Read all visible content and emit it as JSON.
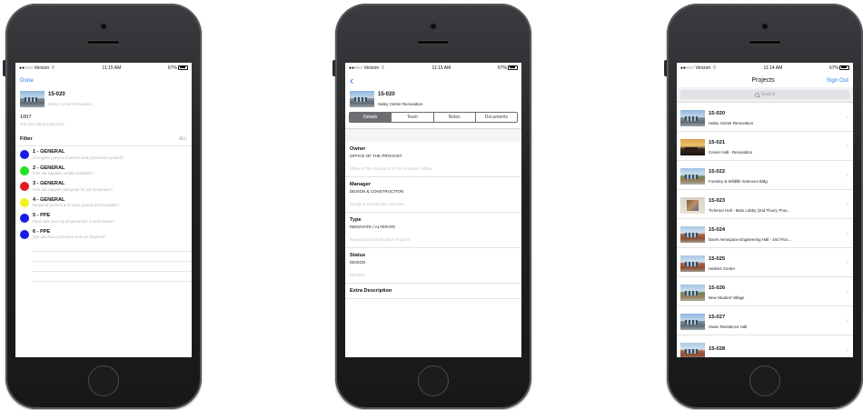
{
  "status_bar": {
    "carrier": "●●○○○ Verizon",
    "wifi_icon": "wifi-icon",
    "battery": "67%",
    "time_1": "11:15 AM",
    "time_2": "11:15 AM",
    "time_3": "11:14 AM"
  },
  "inspection": {
    "nav": {
      "done_label": "Done"
    },
    "project": {
      "number": "15-020",
      "name": "Haley Center Renovation"
    },
    "code": {
      "number": "1007",
      "description": "Job site safety inspection"
    },
    "filter": {
      "label": "Filter",
      "all_label": "ALL"
    },
    "categories": [
      {
        "title": "1 - GENERAL",
        "question": "Emergency phone numbers and procedures posted?",
        "color": "#1a1ae6"
      },
      {
        "title": "2 - GENERAL",
        "question": "First aid supplies readily available?",
        "color": "#22e022"
      },
      {
        "title": "3 - GENERAL",
        "question": "First aid supplies adequate for job manpower?",
        "color": "#e41b1b"
      },
      {
        "title": "4 - GENERAL",
        "question": "Required posters and signs posted and readable?",
        "color": "#f2f21c"
      },
      {
        "title": "5 - PPE",
        "question": "Hard hats worn by all personnel in work areas?",
        "color": "#1a1ae6"
      },
      {
        "title": "6 - PPE",
        "question": "Eye and face protection worn as required?",
        "color": "#1a1ae6"
      }
    ]
  },
  "project_detail": {
    "nav": {
      "back_icon": "chevron-left-icon"
    },
    "project": {
      "number": "15-020",
      "name": "Haley Center Renovation"
    },
    "tabs": [
      "Details",
      "Team",
      "Notes",
      "Documents"
    ],
    "fields": [
      {
        "label": "Owner",
        "value": "OFFICE OF THE PROVOST",
        "secondary": "Office of The Provost & VP for Academic Affairs"
      },
      {
        "label": "Manager",
        "value": "DESIGN & CONSTRUCTION",
        "secondary": "Design & Construction Services"
      },
      {
        "label": "Type",
        "value": "RENOVATE / ALTERATE",
        "secondary": "Renovation and Alteration Projects"
      },
      {
        "label": "Status",
        "value": "DESIGN",
        "secondary": "DESIGN"
      },
      {
        "label": "Extra Description",
        "value": "",
        "secondary": ""
      }
    ]
  },
  "projects_list": {
    "nav": {
      "title": "Projects",
      "sign_out_label": "Sign Out"
    },
    "search": {
      "placeholder": "Search"
    },
    "items": [
      {
        "number": "15-020",
        "name": "Haley Center Renovation"
      },
      {
        "number": "15-021",
        "name": "Comer Hall - Renovation"
      },
      {
        "number": "15-022",
        "name": "Forestry & Wildlife Sciences Bldg"
      },
      {
        "number": "15-023",
        "name": "Tichenor Hall - Main Lobby (2nd Floor), Prov..."
      },
      {
        "number": "15-024",
        "name": "Davis Aerospace Engineering Hall - 2nd Floo..."
      },
      {
        "number": "15-025",
        "name": "Harbert Center"
      },
      {
        "number": "15-026",
        "name": "New Student Village"
      },
      {
        "number": "15-027",
        "name": "Owen Residence Hall"
      },
      {
        "number": "15-028",
        "name": ""
      }
    ]
  }
}
